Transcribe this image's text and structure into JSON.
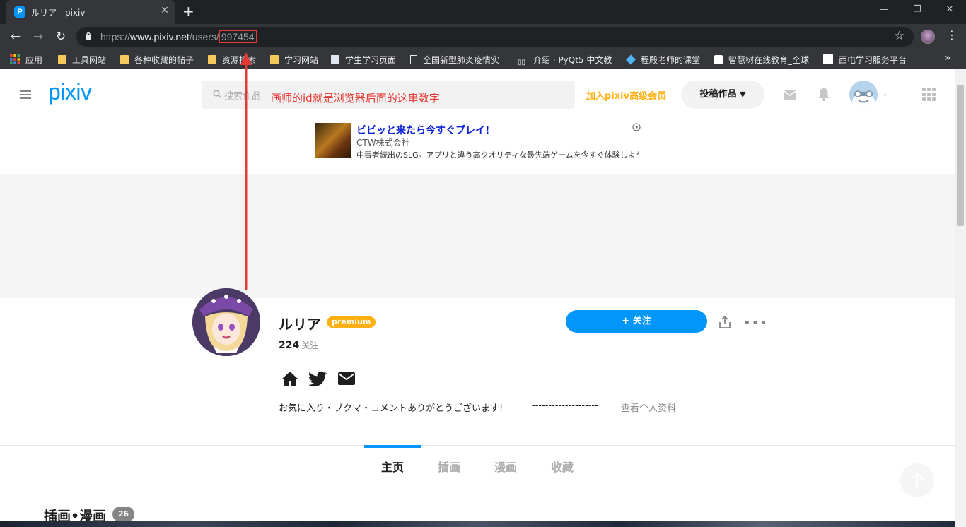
{
  "browser": {
    "tab_title": "ルリア - pixiv",
    "tab_favicon": "P",
    "tab_close": "✕",
    "new_tab": "+",
    "window_controls": [
      "—",
      "❐",
      "✕"
    ],
    "url_prefix": "https://",
    "url_host": "www.pixiv.net",
    "url_path": "/users/",
    "url_id": "997454",
    "bookmarks": [
      {
        "label": "应用",
        "icon": "apps-grid-icon"
      },
      {
        "label": "工具网站",
        "icon": "folder-icon"
      },
      {
        "label": "各种收藏的帖子",
        "icon": "folder-icon"
      },
      {
        "label": "资源搜索",
        "icon": "folder-icon"
      },
      {
        "label": "学习网站",
        "icon": "folder-icon"
      },
      {
        "label": "学生学习页面",
        "icon": "page-icon"
      },
      {
        "label": "全国新型肺炎疫情实",
        "icon": "document-icon"
      },
      {
        "label": "介绍 · PyQt5 中文教",
        "icon": "book-icon"
      },
      {
        "label": "程殿老师的课堂",
        "icon": "diamond-icon"
      },
      {
        "label": "智慧树在线教育_全球",
        "icon": "tree-icon"
      },
      {
        "label": "西电学习服务平台",
        "icon": "page-icon"
      }
    ],
    "bookmarks_more": "»"
  },
  "header": {
    "logo": "pixiv",
    "search_placeholder": "搜索作品",
    "premium_link": "加入pixiv高级会员",
    "post_button": "投稿作品",
    "post_chevron": "⌄"
  },
  "annotation": {
    "text": "画师的id就是浏览器后面的这串数字",
    "color": "#e53935"
  },
  "ad": {
    "title": "ビビッと来たら今すぐプレイ!",
    "company": "CTW株式会社",
    "description": "中毒者続出のSLG。アプリと違う高クオリティな最先端ゲームを今すぐ体験しよう"
  },
  "profile": {
    "username": "ルリア",
    "premium_badge": "premium",
    "following_count": "224",
    "following_label": "关注",
    "follow_button": "+ 关注",
    "more": "•••",
    "bio": "お気に入り・ブクマ・コメントありがとうございます!",
    "bio_dashes": "--------------------",
    "view_profile": "查看个人资料"
  },
  "tabs": [
    {
      "label": "主页",
      "active": true
    },
    {
      "label": "插画",
      "active": false
    },
    {
      "label": "漫画",
      "active": false
    },
    {
      "label": "收藏",
      "active": false
    }
  ],
  "section": {
    "title": "插画•漫画",
    "count": "26"
  },
  "colors": {
    "pixiv_blue": "#0096fa",
    "premium_orange": "#ffaf0f",
    "browser_dark": "#35363a"
  }
}
